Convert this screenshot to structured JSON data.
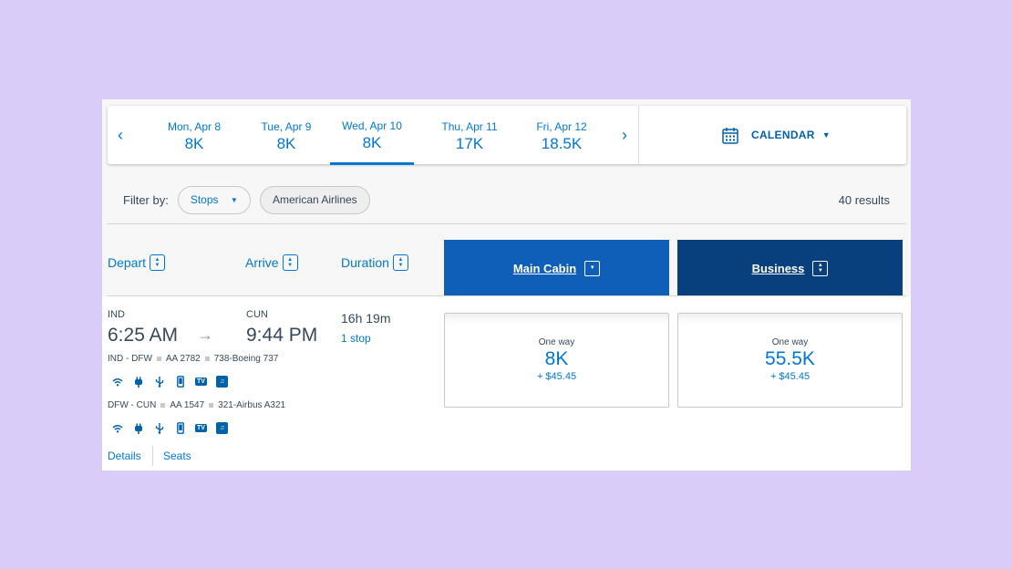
{
  "dates": [
    {
      "label": "Mon, Apr 8",
      "price": "8K"
    },
    {
      "label": "Tue, Apr 9",
      "price": "8K"
    },
    {
      "label": "Wed, Apr 10",
      "price": "8K"
    },
    {
      "label": "Thu, Apr 11",
      "price": "17K"
    },
    {
      "label": "Fri, Apr 12",
      "price": "18.5K"
    }
  ],
  "nav": {
    "prev": "‹",
    "next": "›"
  },
  "calendar": {
    "label": "CALENDAR",
    "caret": "▼"
  },
  "filter": {
    "label": "Filter by:",
    "stops": "Stops",
    "stops_caret": "▼",
    "airline": "American Airlines"
  },
  "results": "40 results",
  "columns": {
    "depart": "Depart",
    "arrive": "Arrive",
    "duration": "Duration",
    "main_cabin": "Main Cabin",
    "business": "Business"
  },
  "flight": {
    "origin": "IND",
    "depart_time": "6:25 AM",
    "arrow": "→",
    "destination": "CUN",
    "arrive_time": "9:44 PM",
    "duration": "16h 19m",
    "stops": "1 stop",
    "segments": [
      {
        "route": "IND - DFW",
        "flight": "AA 2782",
        "aircraft": "738-Boeing 737"
      },
      {
        "route": "DFW - CUN",
        "flight": "AA 1547",
        "aircraft": "321-Airbus A321"
      }
    ],
    "amenities": [
      "wifi-icon",
      "power-outlet-icon",
      "usb-icon",
      "mobile-device-icon",
      "tv-icon",
      "music-icon"
    ],
    "details_link": "Details",
    "seats_link": "Seats",
    "fares": {
      "main": {
        "type": "One way",
        "amount": "8K",
        "taxes": "+ $45.45"
      },
      "business": {
        "type": "One way",
        "amount": "55.5K",
        "taxes": "+ $45.45"
      }
    }
  },
  "colors": {
    "accent": "#0078d2",
    "main_cabin": "#0f5fb8",
    "business": "#08407d",
    "background": "#d9ccf9"
  }
}
